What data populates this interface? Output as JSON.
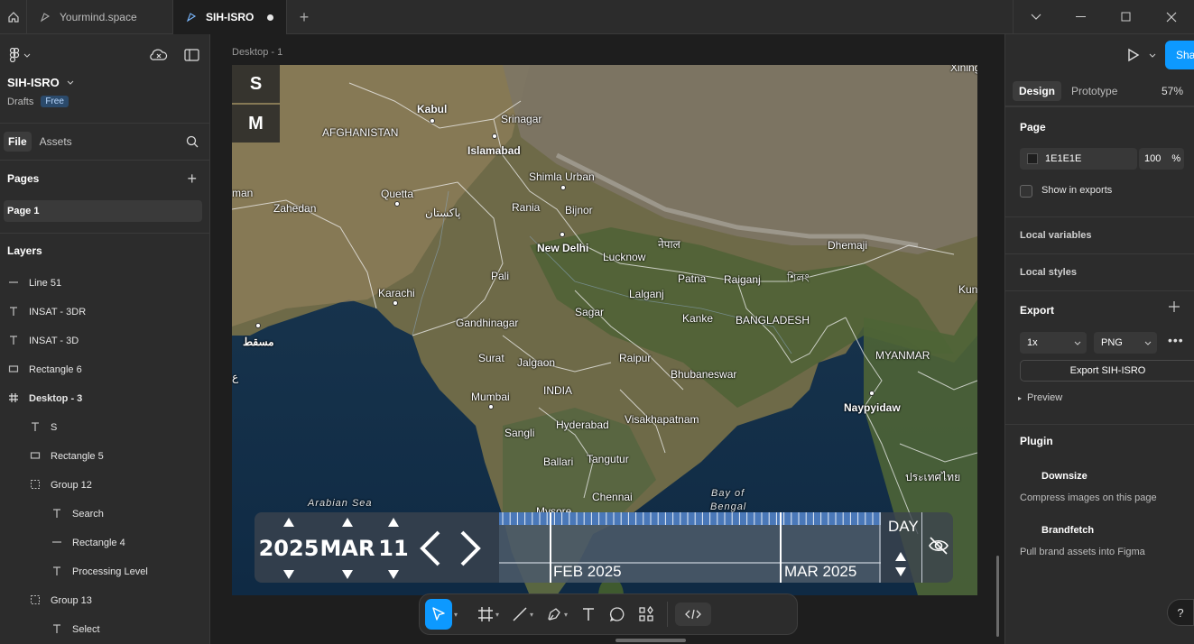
{
  "tabs": [
    {
      "label": "Yourmind.space",
      "active": false
    },
    {
      "label": "SIH-ISRO",
      "active": true,
      "unsaved": true
    }
  ],
  "left_panel": {
    "project_name": "SIH-ISRO",
    "drafts_label": "Drafts",
    "plan_badge": "Free",
    "tab_file": "File",
    "tab_assets": "Assets",
    "pages_title": "Pages",
    "page_current": "Page 1",
    "layers_title": "Layers",
    "layers": [
      {
        "icon": "line-icon",
        "label": "Line 51",
        "depth": 0,
        "bold": false
      },
      {
        "icon": "text-icon",
        "label": "INSAT - 3DR",
        "depth": 0,
        "bold": false
      },
      {
        "icon": "text-icon",
        "label": "INSAT - 3D",
        "depth": 0,
        "bold": false
      },
      {
        "icon": "rectangle-icon",
        "label": "Rectangle 6",
        "depth": 0,
        "bold": false
      },
      {
        "icon": "frame-icon",
        "label": "Desktop - 3",
        "depth": 0,
        "bold": true
      },
      {
        "icon": "text-icon",
        "label": "S",
        "depth": 1,
        "bold": false
      },
      {
        "icon": "rectangle-icon",
        "label": "Rectangle 5",
        "depth": 1,
        "bold": false
      },
      {
        "icon": "group-icon",
        "label": "Group 12",
        "depth": 1,
        "bold": false
      },
      {
        "icon": "text-icon",
        "label": "Search",
        "depth": 2,
        "bold": false
      },
      {
        "icon": "line-icon",
        "label": "Rectangle 4",
        "depth": 2,
        "bold": false
      },
      {
        "icon": "text-icon",
        "label": "Processing Level",
        "depth": 2,
        "bold": false
      },
      {
        "icon": "group-icon",
        "label": "Group 13",
        "depth": 1,
        "bold": false
      },
      {
        "icon": "text-icon",
        "label": "Select",
        "depth": 2,
        "bold": false
      }
    ]
  },
  "canvas": {
    "frame_label": "Desktop - 1",
    "s_button": "S",
    "m_button": "M",
    "map_labels": [
      {
        "text": "Xining",
        "bold": false
      },
      {
        "text": "Kabul",
        "bold": true
      },
      {
        "text": "Srinagar",
        "bold": false
      },
      {
        "text": "AFGHANISTAN",
        "bold": false
      },
      {
        "text": "Islamabad",
        "bold": true
      },
      {
        "text": "Shimla Urban",
        "bold": false
      },
      {
        "text": "Quetta",
        "bold": false
      },
      {
        "text": "Zahedan",
        "bold": false
      },
      {
        "text": "پاکستان",
        "bold": false
      },
      {
        "text": "Rania",
        "bold": false
      },
      {
        "text": "Bijnor",
        "bold": false
      },
      {
        "text": "New Delhi",
        "bold": true
      },
      {
        "text": "नेपाल",
        "bold": false
      },
      {
        "text": "Dhemaji",
        "bold": false
      },
      {
        "text": "Lucknow",
        "bold": false
      },
      {
        "text": "Pali",
        "bold": false
      },
      {
        "text": "Karachi",
        "bold": false
      },
      {
        "text": "Patna",
        "bold": false
      },
      {
        "text": "Raiganj",
        "bold": false
      },
      {
        "text": "শিলং",
        "bold": false
      },
      {
        "text": "Kun",
        "bold": false
      },
      {
        "text": "Lalganj",
        "bold": false
      },
      {
        "text": "Sagar",
        "bold": false
      },
      {
        "text": "Kanke",
        "bold": false
      },
      {
        "text": "BANGLADESH",
        "bold": false
      },
      {
        "text": "Gandhinagar",
        "bold": false
      },
      {
        "text": "مسقط",
        "bold": true
      },
      {
        "text": "Surat",
        "bold": false
      },
      {
        "text": "Jalgaon",
        "bold": false
      },
      {
        "text": "Raipur",
        "bold": false
      },
      {
        "text": "MYANMAR",
        "bold": false
      },
      {
        "text": "Bhubaneswar",
        "bold": false
      },
      {
        "text": "INDIA",
        "bold": false
      },
      {
        "text": "Mumbai",
        "bold": false
      },
      {
        "text": "Naypyidaw",
        "bold": true
      },
      {
        "text": "Hyderabad",
        "bold": false
      },
      {
        "text": "Visakhapatnam",
        "bold": false
      },
      {
        "text": "Sangli",
        "bold": false
      },
      {
        "text": "Ballari",
        "bold": false
      },
      {
        "text": "Tangutur",
        "bold": false
      },
      {
        "text": "ประเทศไทย",
        "bold": false
      },
      {
        "text": "Chennai",
        "bold": false
      },
      {
        "text": "Mysore",
        "bold": false
      },
      {
        "text": "man",
        "bold": false
      },
      {
        "text": "ع",
        "bold": false
      }
    ],
    "sea_labels": [
      "Arabian Sea",
      "Bay of",
      "Bengal"
    ],
    "timeline": {
      "year": "2025",
      "month": "MAR",
      "day": "11",
      "month_marks": [
        "FEB 2025",
        "MAR 2025"
      ],
      "granularity": "DAY"
    }
  },
  "toolbar": {
    "tools": [
      "move-tool",
      "frame-tool",
      "line-tool",
      "pen-tool",
      "text-tool",
      "comment-tool",
      "actions-tool",
      "dev-mode-toggle"
    ]
  },
  "right_panel": {
    "share_label": "Sha",
    "tab_design": "Design",
    "tab_prototype": "Prototype",
    "zoom": "57%",
    "page_title": "Page",
    "page_color": "1E1E1E",
    "page_opacity": "100",
    "percent_sign": "%",
    "show_in_exports": "Show in exports",
    "local_variables": "Local variables",
    "local_styles": "Local styles",
    "export_title": "Export",
    "export_scale": "1x",
    "export_format": "PNG",
    "export_button": "Export SIH-ISRO",
    "preview": "Preview",
    "plugin_title": "Plugin",
    "plugins": [
      {
        "name": "Downsize",
        "desc": "Compress images on this page"
      },
      {
        "name": "Brandfetch",
        "desc": "Pull brand assets into Figma"
      }
    ],
    "help": "?"
  }
}
